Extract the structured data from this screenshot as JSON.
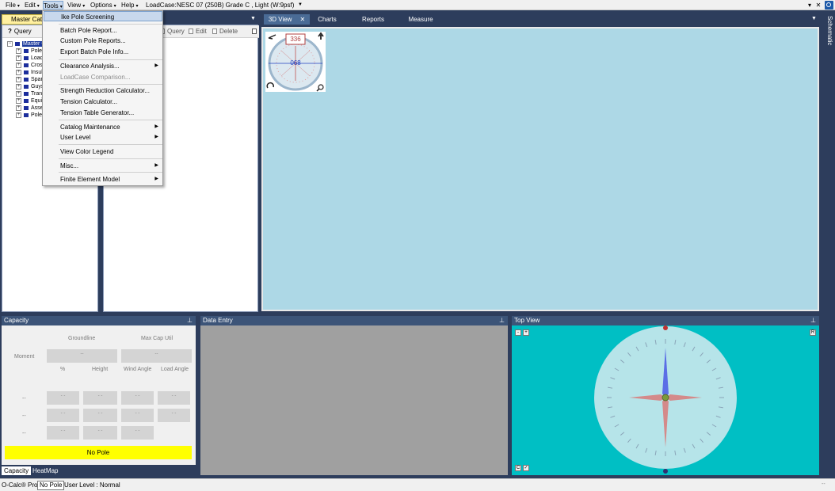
{
  "menubar": {
    "items": [
      {
        "label": "File"
      },
      {
        "label": "Edit"
      },
      {
        "label": "Tools"
      },
      {
        "label": "View"
      },
      {
        "label": "Options"
      },
      {
        "label": "Help"
      }
    ],
    "loadcase_label": "LoadCase:",
    "loadcase_value": "NESC  07 (250B) Grade C , Light (W:9psf)",
    "right_icons": [
      "▾",
      "✕"
    ]
  },
  "tools_menu": {
    "items": [
      {
        "label": "Ike Pole Screening",
        "highlight": true
      },
      {
        "label": "Batch Pole Report..."
      },
      {
        "label": "Custom Pole Reports..."
      },
      {
        "label": "Export Batch Pole Info..."
      },
      {
        "label": "Clearance Analysis...",
        "submenu": true
      },
      {
        "label": "LoadCase Comparison...",
        "disabled": true
      },
      {
        "label": "Strength Reduction Calculator..."
      },
      {
        "label": "Tension Calculator..."
      },
      {
        "label": "Tension Table Generator..."
      },
      {
        "label": "Catalog Maintenance",
        "submenu": true
      },
      {
        "label": "User Level",
        "submenu": true
      },
      {
        "label": "View Color Legend"
      },
      {
        "label": "Misc...",
        "submenu": true
      },
      {
        "label": "Finite Element Model",
        "submenu": true
      }
    ]
  },
  "catalog": {
    "tab_label": "Master Catalog",
    "query_label": "Query",
    "root_label": "Master Catalog",
    "children": [
      "Poles",
      "Loads",
      "Crossarms",
      "Insulators",
      "Spans",
      "Guys",
      "Transformers",
      "Equipment",
      "Assemblies",
      "Pole Attachments"
    ]
  },
  "list_panel": {
    "tools": [
      "Query",
      "Edit",
      "Delete"
    ]
  },
  "doc_tabs": {
    "items": [
      "3D View",
      "Charts",
      "Reports",
      "Measure"
    ],
    "close_symbol": "✕"
  },
  "compass3d": {
    "top_value": "336",
    "center_value": "068"
  },
  "schematic": {
    "label": "Schematic"
  },
  "capacity": {
    "header": "Capacity",
    "groundline_label": "Groundline",
    "maxcap_label": "Max Cap Util",
    "moment_label": "Moment",
    "percent_label": "%",
    "height_label": "Height",
    "wind_angle_label": "Wind Angle",
    "load_angle_label": "Load Angle",
    "dash": "--",
    "placeholder": "- -",
    "no_pole": "No Pole",
    "tabs": [
      "Capacity",
      "HeatMap"
    ]
  },
  "data_entry": {
    "header": "Data Entry"
  },
  "top_view": {
    "header": "Top View",
    "btn_minus": "-",
    "btn_plus": "+",
    "btn_r": "R",
    "btn_c": "C"
  },
  "statusbar": {
    "app_name": "O-Calc® Pro",
    "no_pole": "No Pole",
    "user_level": "User Level : Normal"
  },
  "colors": {
    "workspace": "#2d3d5c",
    "view3d_bg": "#add8e6",
    "topview_bg": "#00bfc4",
    "no_pole_bar": "#ffff00",
    "catalog_tab": "#fff0a0"
  }
}
